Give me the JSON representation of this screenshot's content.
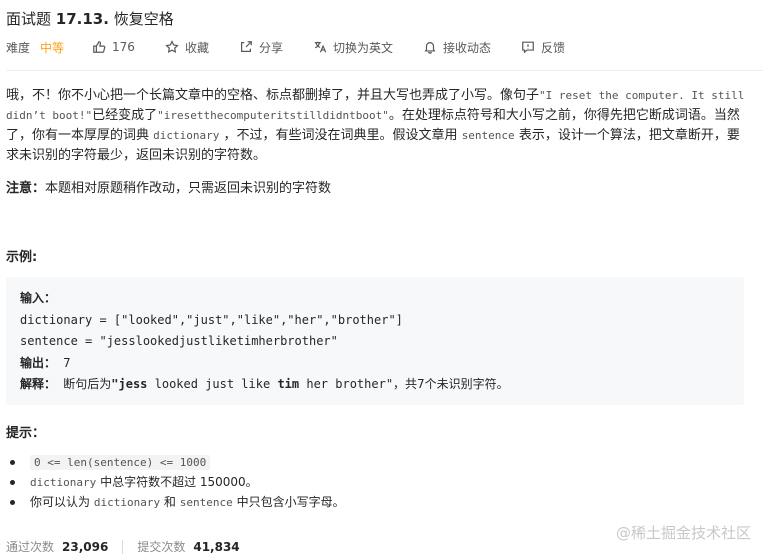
{
  "header": {
    "title_prefix": "面试题 ",
    "title_num": "17.13.",
    "title_name": " 恢复空格"
  },
  "meta": {
    "difficulty_label": "难度",
    "difficulty": "中等",
    "likes": "176",
    "favorite": "收藏",
    "share": "分享",
    "switch_lang": "切换为英文",
    "notify": "接收动态",
    "feedback": "反馈"
  },
  "description": {
    "p1": "哦，不！你不小心把一个长篇文章中的空格、标点都删掉了，并且大写也弄成了小写。像句子",
    "c1": "\"I reset the computer. It still didn’t boot!\"",
    "p2": "已经变成了",
    "c2": "\"iresetthecomputeritstilldidntboot\"",
    "p3": "。在处理标点符号和大小写之前，你得先把它断成词语。当然了，你有一本厚厚的词典",
    "c3": "dictionary",
    "p4": "，不过，有些词没在词典里。假设文章用",
    "c4": "sentence",
    "p5": "表示，设计一个算法，把文章断开，要求未识别的字符最少，返回未识别的字符数。"
  },
  "note": {
    "label": "注意：",
    "text": "本题相对原题稍作改动，只需返回未识别的字符数"
  },
  "example": {
    "heading": "示例:",
    "input_label": "输入：",
    "line_dict": "dictionary = [\"looked\",\"just\",\"like\",\"her\",\"brother\"]",
    "line_sentence": "sentence = \"jesslookedjustliketimherbrother\"",
    "output_label": "输出：",
    "output_value": "7",
    "explain_label": "解释：",
    "explain_pre": "断句后为",
    "explain_b1": "\"jess",
    "explain_mid1": " looked just like ",
    "explain_b2": "tim",
    "explain_mid2": " her brother\"",
    "explain_post": "，共7个未识别字符。"
  },
  "tips": {
    "heading": "提示：",
    "t1": "0 <= len(sentence) <= 1000",
    "t2_code": "dictionary",
    "t2_text": "中总字符数不超过 150000。",
    "t3_pre": "你可以认为",
    "t3_c1": "dictionary",
    "t3_mid": "和",
    "t3_c2": "sentence",
    "t3_post": "中只包含小写字母。"
  },
  "footer": {
    "pass_label": "通过次数",
    "pass_value": "23,096",
    "submit_label": "提交次数",
    "submit_value": "41,834"
  },
  "watermark": "@稀土掘金技术社区",
  "colors": {
    "difficulty": "#ffa116",
    "code_bg": "#f7f8fa",
    "muted": "#8c8c8c"
  }
}
